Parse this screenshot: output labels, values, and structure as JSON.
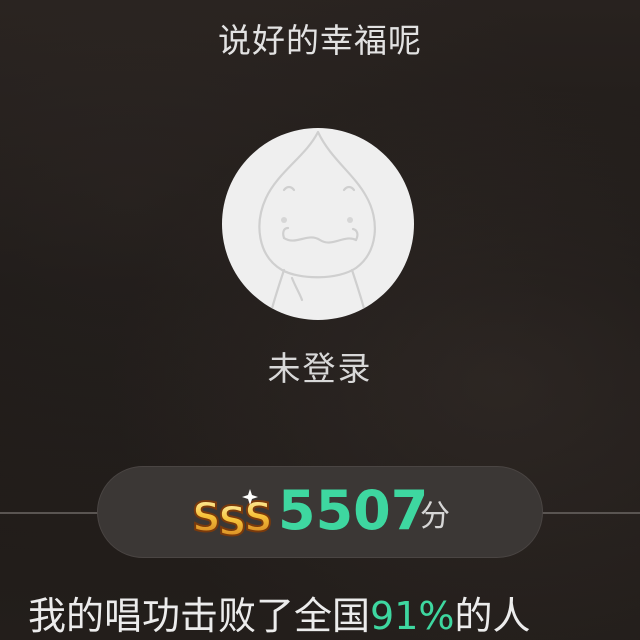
{
  "header": {
    "song_title": "说好的幸福呢"
  },
  "profile": {
    "avatar_icon": "default-avatar-icon",
    "login_status": "未登录"
  },
  "score": {
    "grade": "SSS",
    "value": "5507",
    "unit": "分",
    "accent_color": "#3ed7a0"
  },
  "result": {
    "prefix": "我的唱功击败了全国",
    "percent": "91%",
    "suffix": "的人"
  }
}
